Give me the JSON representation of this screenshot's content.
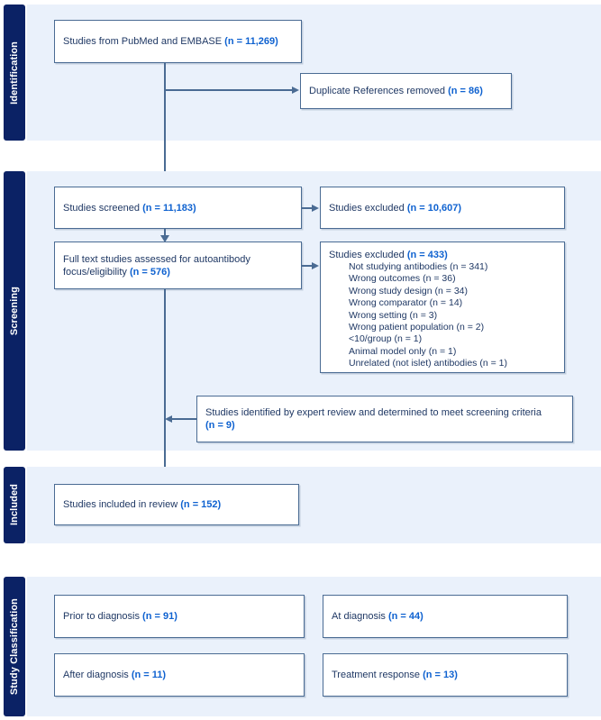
{
  "figure": {
    "type": "prisma-flow-diagram",
    "accent_dark": "#0b2265",
    "accent_band_bg": "#eaf1fb",
    "box_border": "#4a6b93",
    "text_color": "#1f3864",
    "count_color": "#0f62d0"
  },
  "stages": [
    {
      "id": "identification",
      "label": "Identification"
    },
    {
      "id": "screening",
      "label": "Screening"
    },
    {
      "id": "included",
      "label": "Included"
    },
    {
      "id": "classification",
      "label": "Study Classification"
    }
  ],
  "boxes": {
    "sources": {
      "text": "Studies from PubMed and EMBASE ",
      "count": "(n = 11,269)"
    },
    "duplicates": {
      "text": "Duplicate References removed ",
      "count": "(n = 86)"
    },
    "screened": {
      "text": "Studies screened ",
      "count": "(n = 11,183)"
    },
    "excluded_screen": {
      "text": "Studies excluded ",
      "count": "(n = 10,607)"
    },
    "fulltext": {
      "line1": "Full text studies assessed for autoantibody",
      "line2": "focus/eligibility ",
      "count": "(n = 576)"
    },
    "excluded_fulltext": {
      "text": "Studies excluded ",
      "count": "(n = 433)",
      "reasons": [
        "Not studying antibodies (n = 341)",
        "Wrong outcomes (n = 36)",
        "Wrong study design (n = 34)",
        "Wrong comparator (n = 14)",
        "Wrong setting (n = 3)",
        "Wrong patient population (n = 2)",
        "<10/group (n = 1)",
        "Animal model only (n = 1)",
        "Unrelated (not islet) antibodies (n = 1)"
      ]
    },
    "expert_review": {
      "line1": "Studies identified by expert review and determined to meet screening criteria",
      "count": "(n = 9)"
    },
    "included": {
      "text": "Studies included in review ",
      "count": "(n = 152)"
    },
    "prior_to_diagnosis": {
      "text": "Prior to diagnosis ",
      "count": "(n =  91)"
    },
    "at_diagnosis": {
      "text": "At diagnosis ",
      "count": "(n = 44)"
    },
    "after_diagnosis": {
      "text": "After diagnosis ",
      "count": "(n = 11)"
    },
    "treatment_response": {
      "text": "Treatment response ",
      "count": "(n = 13)"
    }
  }
}
